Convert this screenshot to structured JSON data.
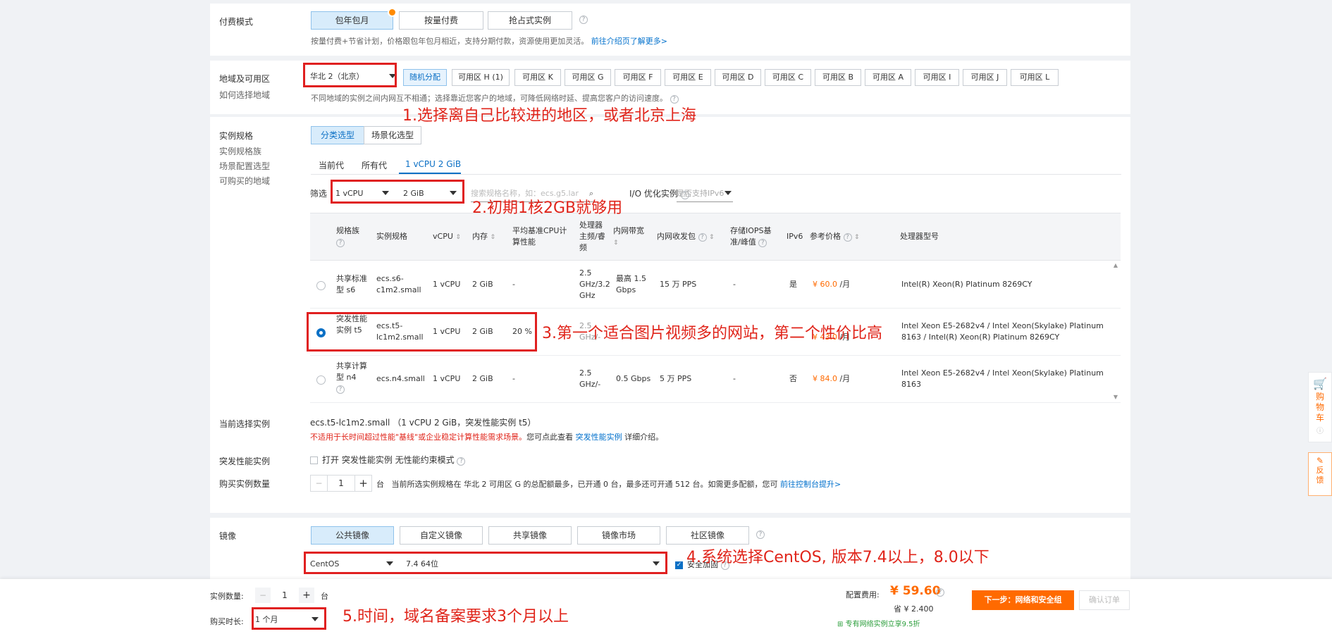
{
  "billing": {
    "label": "付费模式",
    "options": [
      "包年包月",
      "按量付费",
      "抢占式实例"
    ],
    "note": "按量付费+节省计划，价格跟包年包月相近，支持分期付款，资源使用更加灵活。",
    "note_link": "前往介绍页了解更多>"
  },
  "region": {
    "label": "地域及可用区",
    "sub": "如何选择地域",
    "selected": "华北 2（北京）",
    "zones": [
      "随机分配",
      "可用区 H (1)",
      "可用区 K",
      "可用区 G",
      "可用区 F",
      "可用区 E",
      "可用区 D",
      "可用区 C",
      "可用区 B",
      "可用区 A",
      "可用区 I",
      "可用区 J",
      "可用区 L"
    ],
    "note": "不同地域的实例之间内网互不相通；选择靠近您客户的地域，可降低网络时延、提高您客户的访问速度。"
  },
  "spec": {
    "label": "实例规格",
    "side_links": [
      "实例规格族",
      "场景配置选型",
      "可购买的地域"
    ],
    "tabs": [
      "分类选型",
      "场景化选型"
    ],
    "subtabs": [
      "当前代",
      "所有代",
      "1 vCPU 2 GiB"
    ],
    "filter_label": "筛选",
    "cpu": "1 vCPU",
    "mem": "2 GiB",
    "search_placeholder": "搜索规格名称，如：ecs.g5.lar",
    "io_label": "I/O 优化实例",
    "ipv6_placeholder": "是否支持IPv6",
    "headers": {
      "family": "规格族",
      "name": "实例规格",
      "vcpu": "vCPU",
      "mem": "内存",
      "baseline": "平均基准CPU计算性能",
      "freq": "处理器主频/睿频",
      "bw": "内网带宽",
      "pps": "内网收发包",
      "iops": "存储IOPS基准/峰值",
      "ipv6": "IPv6",
      "price": "参考价格",
      "cpu_model": "处理器型号"
    },
    "rows": [
      {
        "family": "共享标准型 s6",
        "name": "ecs.s6-c1m2.small",
        "vcpu": "1 vCPU",
        "mem": "2 GiB",
        "baseline": "-",
        "freq": "2.5 GHz/3.2 GHz",
        "bw": "最高 1.5 Gbps",
        "pps": "15 万 PPS",
        "iops": "-",
        "ipv6": "是",
        "price": "¥ 60.0",
        "unit": "/月",
        "cpu_model": "Intel(R) Xeon(R) Platinum 8269CY"
      },
      {
        "family": "突发性能实例 t5",
        "name": "ecs.t5-lc1m2.small",
        "vcpu": "1 vCPU",
        "mem": "2 GiB",
        "baseline": "20 %",
        "freq": "2.5 GHz/-",
        "bw": "",
        "pps": "",
        "iops": "",
        "ipv6": "",
        "price": "¥ 43.0",
        "unit": "/月",
        "cpu_model": "Intel Xeon E5-2682v4 / Intel Xeon(Skylake) Platinum 8163 / Intel(R) Xeon(R) Platinum 8269CY"
      },
      {
        "family": "共享计算型 n4",
        "name": "ecs.n4.small",
        "vcpu": "1 vCPU",
        "mem": "2 GiB",
        "baseline": "-",
        "freq": "2.5 GHz/-",
        "bw": "0.5 Gbps",
        "pps": "5 万 PPS",
        "iops": "-",
        "ipv6": "否",
        "price": "¥ 84.0",
        "unit": "/月",
        "cpu_model": "Intel Xeon E5-2682v4 / Intel Xeon(Skylake) Platinum 8163"
      }
    ],
    "current_label": "当前选择实例",
    "current_value": "ecs.t5-lc1m2.small （1 vCPU 2 GiB，突发性能实例 t5）",
    "current_warn": "不适用于长时间超过性能\"基线\"或企业稳定计算性能需求场景。",
    "current_info": "您可点此查看",
    "current_link": "突发性能实例",
    "current_tail": "详细介绍。"
  },
  "burst": {
    "label": "突发性能实例",
    "checkbox": "打开 突发性能实例 无性能约束模式"
  },
  "quantity": {
    "label": "购买实例数量",
    "value": "1",
    "unit": "台",
    "note": "当前所选实例规格在 华北 2 可用区 G 的总配额最多，已开通 0 台，最多还可开通 512 台。如需更多配额，您可",
    "link": "前往控制台提升>"
  },
  "image": {
    "label": "镜像",
    "tabs": [
      "公共镜像",
      "自定义镜像",
      "共享镜像",
      "镜像市场",
      "社区镜像"
    ],
    "os": "CentOS",
    "version": "7.4 64位",
    "harden": "安全加固"
  },
  "footer": {
    "qty_label": "实例数量:",
    "qty": "1",
    "qty_unit": "台",
    "duration_label": "购买时长:",
    "duration": "1 个月",
    "cost_label": "配置费用:",
    "cost": "¥ 59.60",
    "save": "省 ¥ 2.400",
    "promo": "专有网络实例立享9.5折",
    "next": "下一步：网络和安全组",
    "confirm": "确认订单"
  },
  "side": {
    "cart": "购物车",
    "feedback": "反馈"
  },
  "annotations": {
    "a1": "1.选择离自己比较进的地区，或者北京上海",
    "a2": "2.初期1核2GB就够用",
    "a3": "3.第一个适合图片视频多的网站，第二个性价比高",
    "a4": "4.系统选择CentOS, 版本7.4以上，8.0以下",
    "a5": "5.时间，域名备案要求3个月以上"
  },
  "colors": {
    "accent": "#0c70c5",
    "price": "#ff6a00",
    "annotation": "#e0241a",
    "primary_button": "#ff6a00"
  }
}
